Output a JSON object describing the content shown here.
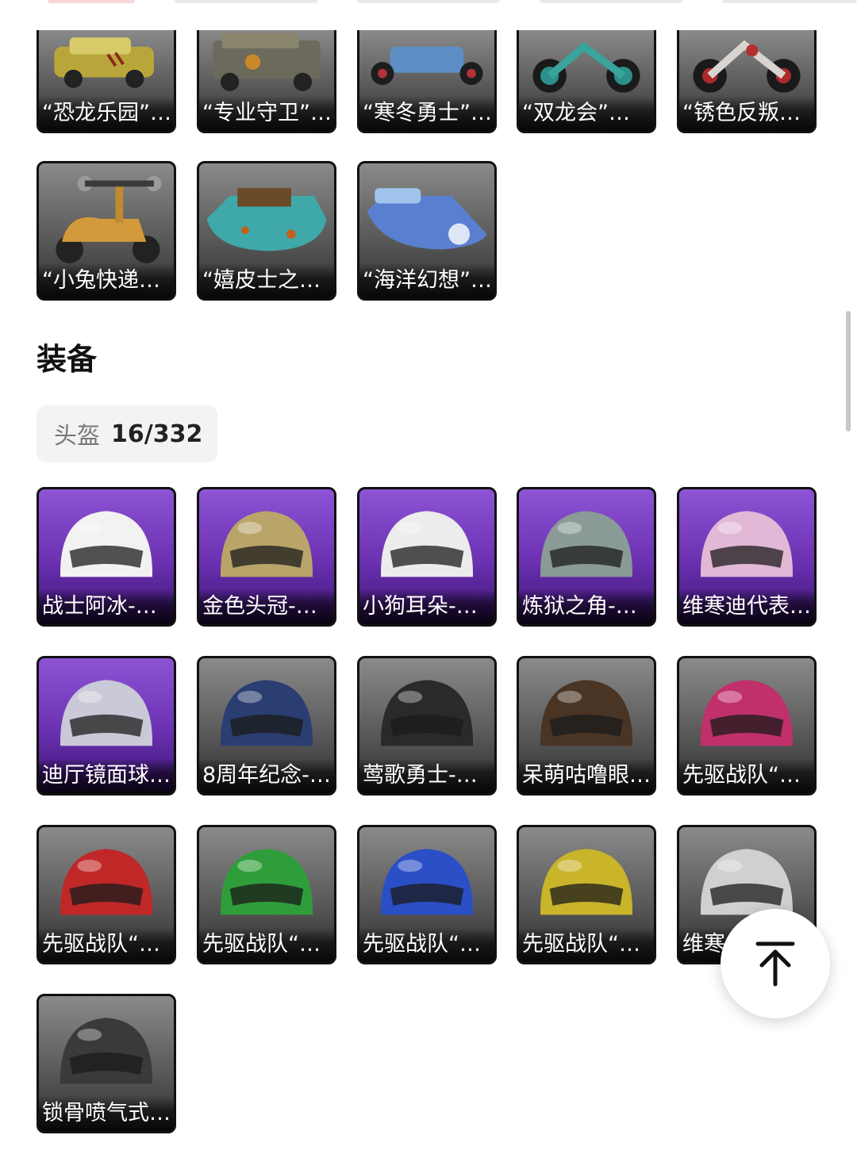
{
  "vehicles": [
    {
      "label": "“恐龙乐园”…",
      "icon": "car-icon"
    },
    {
      "label": "“专业守卫”…",
      "icon": "jeep-icon"
    },
    {
      "label": "“寒冬勇士”…",
      "icon": "buggy-icon"
    },
    {
      "label": "“双龙会”…",
      "icon": "motorcycle-icon"
    },
    {
      "label": "“锈色反叛…",
      "icon": "motorcycle-icon"
    },
    {
      "label": "“小兔快递…",
      "icon": "scooter-icon"
    },
    {
      "label": "“嬉皮士之…",
      "icon": "boat-icon"
    },
    {
      "label": "“海洋幻想”…",
      "icon": "jetski-icon"
    }
  ],
  "equipment_section": {
    "title": "装备",
    "filter_chip": {
      "label": "头盔",
      "count": "16/332"
    }
  },
  "helmets": [
    {
      "label": "战士阿冰-…",
      "rarity": "purple",
      "color": "#f2f2f2"
    },
    {
      "label": "金色头冠-…",
      "rarity": "purple",
      "color": "#b9a56a"
    },
    {
      "label": "小狗耳朵-…",
      "rarity": "purple",
      "color": "#ececec"
    },
    {
      "label": "炼狱之角-…",
      "rarity": "purple",
      "color": "#8a9a96"
    },
    {
      "label": "维寒迪代表…",
      "rarity": "purple",
      "color": "#e2b8d6"
    },
    {
      "label": "迪厅镜面球…",
      "rarity": "purple",
      "color": "#c9c9d8"
    },
    {
      "label": "8周年纪念-…",
      "rarity": "gray",
      "color": "#2b3e72"
    },
    {
      "label": "莺歌勇士-…",
      "rarity": "gray",
      "color": "#2a2a2a"
    },
    {
      "label": "呆萌咕噜眼…",
      "rarity": "gray",
      "color": "#4a3424"
    },
    {
      "label": "先驱战队“…",
      "rarity": "gray",
      "color": "#c0306a"
    },
    {
      "label": "先驱战队“…",
      "rarity": "gray",
      "color": "#c02828"
    },
    {
      "label": "先驱战队“…",
      "rarity": "gray",
      "color": "#2f9e3a"
    },
    {
      "label": "先驱战队“…",
      "rarity": "gray",
      "color": "#2a4fc6"
    },
    {
      "label": "先驱战队“…",
      "rarity": "gray",
      "color": "#c9b42a"
    },
    {
      "label": "维寒",
      "rarity": "gray",
      "color": "#d0d0d0"
    },
    {
      "label": "锁骨喷气式…",
      "rarity": "gray",
      "color": "#3a3a3a"
    }
  ],
  "back_to_top": {
    "icon": "arrow-up-to-top-icon"
  }
}
